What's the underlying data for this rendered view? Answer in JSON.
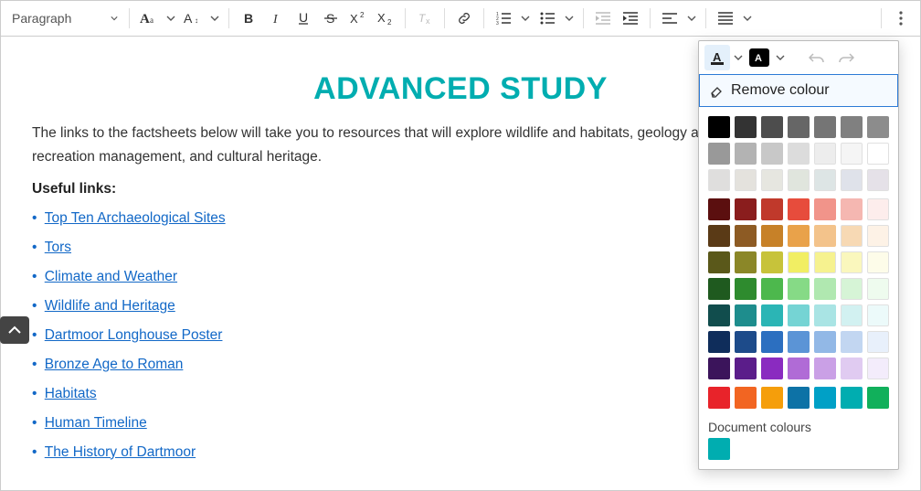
{
  "toolbar": {
    "paragraph": "Paragraph"
  },
  "content": {
    "title": "ADVANCED STUDY",
    "intro": "The links to the factsheets below will take you to resources that will explore wildlife and habitats, geology and landform management, recreation management, and cultural heritage.",
    "useful": "Useful links:",
    "links": [
      "Top Ten Archaeological Sites",
      "Tors",
      "Climate and Weather",
      "Wildlife and Heritage",
      "Dartmoor Longhouse Poster",
      "Bronze Age to Roman",
      "Habitats",
      "Human Timeline",
      "The History of Dartmoor"
    ]
  },
  "picker": {
    "remove": "Remove colour",
    "doc_label": "Document colours",
    "doc_colour": "#00adb0",
    "greys": [
      [
        "#000000",
        "#333333",
        "#4d4d4d",
        "#666666",
        "#757575",
        "#808080",
        "#8c8c8c"
      ],
      [
        "#999999",
        "#b3b3b3",
        "#c8c8c8",
        "#dcdcdc",
        "#ededed",
        "#f5f5f5",
        "#ffffff"
      ],
      [
        "#dfdedd",
        "#e4e2dd",
        "#e6e6e0",
        "#e0e5dd",
        "#dde5e5",
        "#dfe2ea",
        "#e5e1e8"
      ]
    ],
    "palette": [
      [
        "#5b0f0f",
        "#8a1d1d",
        "#c0392b",
        "#e74c3c",
        "#f1948a",
        "#f5b7b1",
        "#fdedec"
      ],
      [
        "#5a3a16",
        "#8d5b24",
        "#c78128",
        "#e9a24a",
        "#f3c38b",
        "#f7d9b4",
        "#fdf2e6"
      ],
      [
        "#5a581a",
        "#8b8728",
        "#c7c33a",
        "#f1ee63",
        "#f6f28f",
        "#faf7bd",
        "#fdfce9"
      ],
      [
        "#1f5a1f",
        "#2e8b2e",
        "#4db84d",
        "#86da86",
        "#b0e8b0",
        "#d6f4d6",
        "#eefbee"
      ],
      [
        "#114d4d",
        "#1e8d8d",
        "#2bb5b5",
        "#75d4d4",
        "#a9e4e4",
        "#d2f1f1",
        "#ecfafa"
      ],
      [
        "#0f2d5b",
        "#1d4b8a",
        "#2c6fc0",
        "#5b94d6",
        "#92b8e6",
        "#c2d6f1",
        "#e8f0fb"
      ],
      [
        "#3b145b",
        "#5b1d8a",
        "#8a2bc0",
        "#b06bd6",
        "#caa0e6",
        "#e0cbf1",
        "#f3ecfb"
      ]
    ],
    "bright": [
      "#e8232a",
      "#f26522",
      "#f59e0b",
      "#0d72a6",
      "#00a0c6",
      "#00adb0",
      "#11b05b"
    ]
  }
}
